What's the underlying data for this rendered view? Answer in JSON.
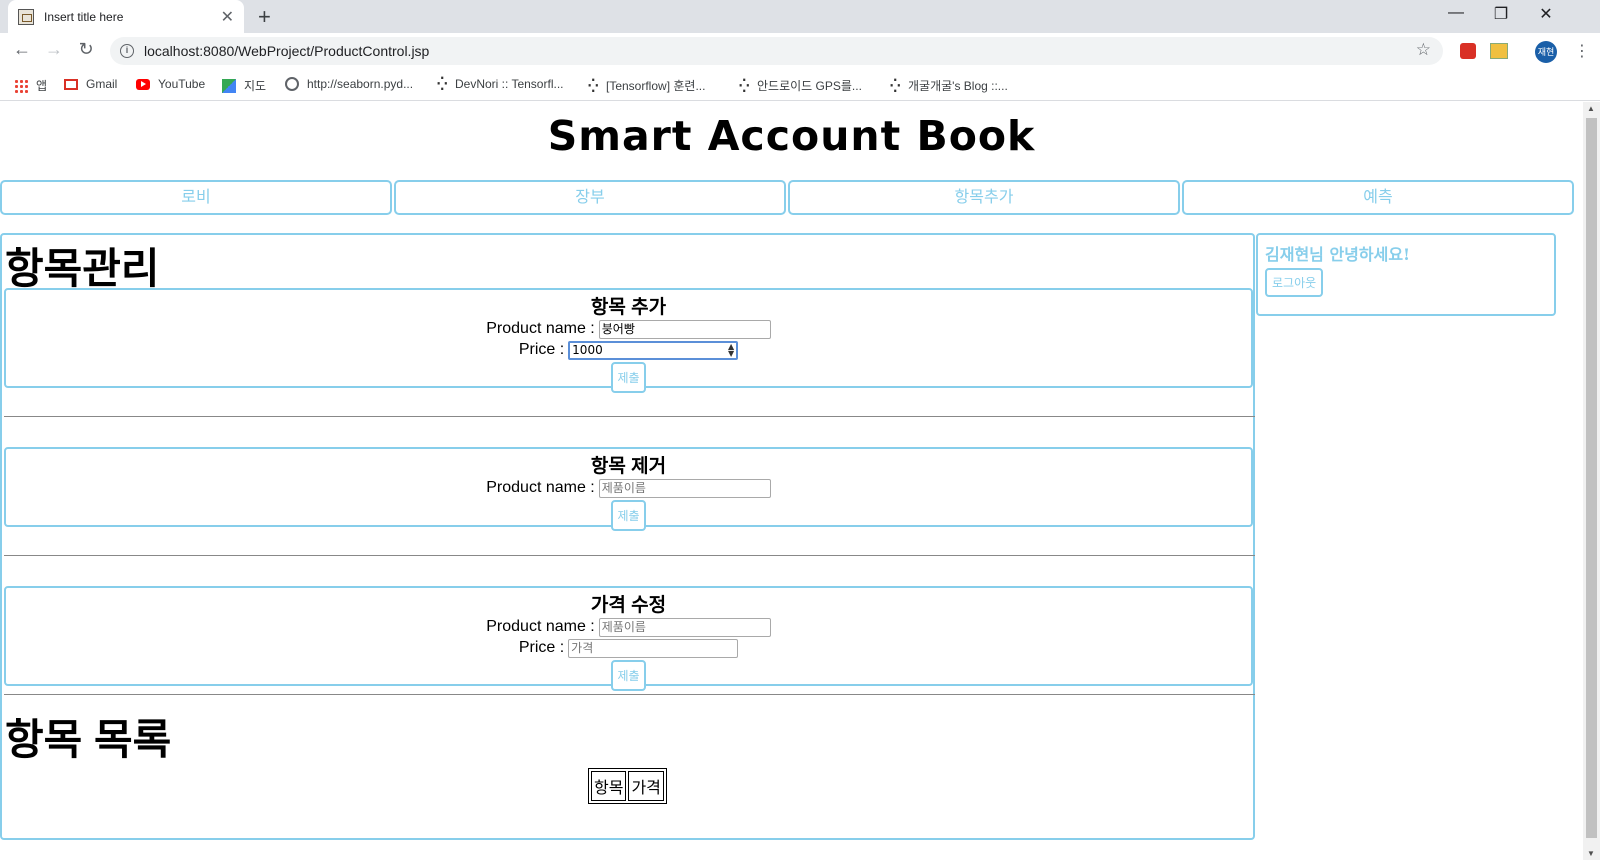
{
  "browser": {
    "tab_title": "Insert title here",
    "url": "localhost:8080/WebProject/ProductControl.jsp",
    "avatar_text": "재현",
    "bookmarks": [
      "앱",
      "Gmail",
      "YouTube",
      "지도",
      "http://seaborn.pyd...",
      "DevNori :: Tensorfl...",
      "[Tensorflow] 훈련...",
      "안드로이드 GPS를...",
      "개굴개굴's Blog ::..."
    ]
  },
  "site": {
    "title": "Smart Account Book",
    "menu": [
      "로비",
      "장부",
      "항목추가",
      "예측"
    ],
    "greeting": "김재현님 안녕하세요!",
    "logout_label": "로그아웃"
  },
  "page": {
    "heading": "항목관리",
    "add": {
      "title": "항목 추가",
      "name_label": "Product name :",
      "name_value": "붕어빵",
      "price_label": "Price :",
      "price_value": "1000",
      "submit_label": "제출"
    },
    "remove": {
      "title": "항목 제거",
      "name_label": "Product name :",
      "name_placeholder": "제품이름",
      "submit_label": "제출"
    },
    "edit": {
      "title": "가격 수정",
      "name_label": "Product name :",
      "name_placeholder": "제품이름",
      "price_label": "Price :",
      "price_placeholder": "가격",
      "submit_label": "제출"
    },
    "list": {
      "heading": "항목 목록",
      "columns": [
        "항목",
        "가격"
      ]
    }
  }
}
